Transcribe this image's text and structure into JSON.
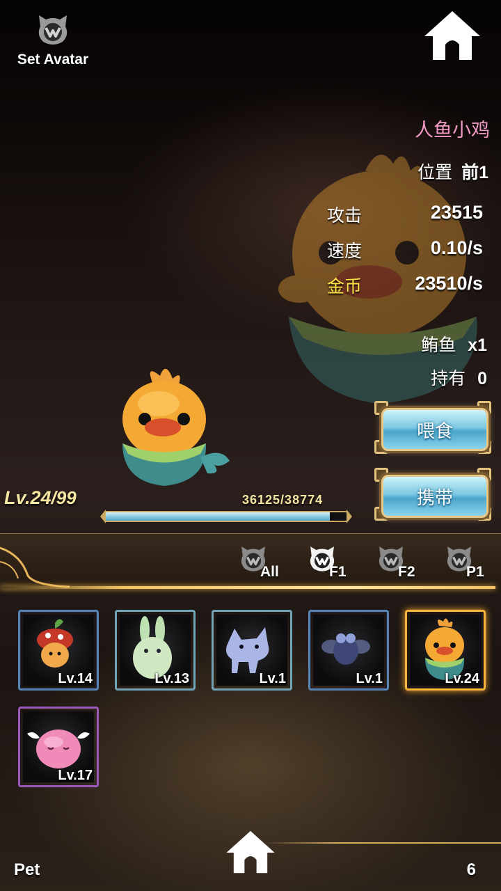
{
  "header": {
    "set_avatar_label": "Set Avatar"
  },
  "pet": {
    "name": "人鱼小鸡",
    "position_label": "位置",
    "position_value": "前1",
    "stats": [
      {
        "label": "攻击",
        "value": "23515",
        "label_color": "#ffffff"
      },
      {
        "label": "速度",
        "value": "0.10/s",
        "label_color": "#ffffff"
      },
      {
        "label": "金币",
        "value": "23510/s",
        "label_color": "#ffe24a"
      }
    ],
    "food_label": "鲔鱼",
    "food_value": "x1",
    "owned_label": "持有",
    "owned_value": "0"
  },
  "actions": {
    "feed_label": "喂食",
    "carry_label": "携带"
  },
  "level": {
    "current": "Lv.24",
    "max": "/99",
    "xp_text": "36125/38774",
    "xp_fraction": 0.932
  },
  "tabs": [
    {
      "label": "All",
      "active": false
    },
    {
      "label": "F1",
      "active": true
    },
    {
      "label": "F2",
      "active": false
    },
    {
      "label": "P1",
      "active": false
    }
  ],
  "cards": [
    {
      "level": "Lv.14",
      "frame": "blue",
      "icon": "mushroom-pet-icon"
    },
    {
      "level": "Lv.13",
      "frame": "teal",
      "icon": "rabbit-pet-icon"
    },
    {
      "level": "Lv.1",
      "frame": "teal",
      "icon": "wolf-pet-icon"
    },
    {
      "level": "Lv.1",
      "frame": "blue",
      "icon": "bug-pet-icon"
    },
    {
      "level": "Lv.24",
      "frame": "gold",
      "icon": "chick-pet-icon"
    },
    {
      "level": "Lv.17",
      "frame": "purple",
      "icon": "winged-blob-pet-icon"
    }
  ],
  "footer": {
    "section_label": "Pet",
    "count": "6"
  },
  "colors": {
    "name_pink": "#f39ac7",
    "level_gold": "#f6e6a2",
    "frame_gold": "#f7b43d"
  }
}
